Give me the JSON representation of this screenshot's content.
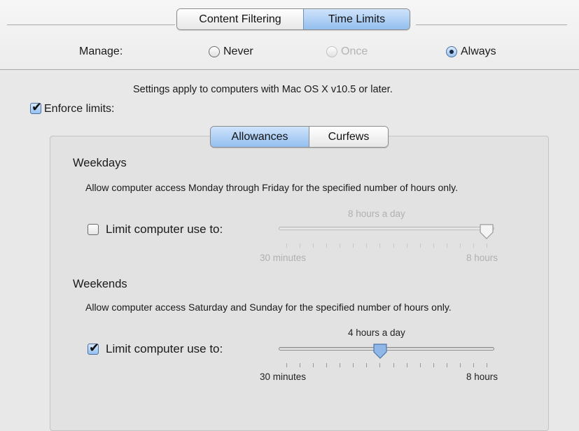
{
  "tabs": [
    {
      "label": "Content Filtering",
      "selected": false
    },
    {
      "label": "Time Limits",
      "selected": true
    }
  ],
  "manage": {
    "label": "Manage:",
    "options": [
      {
        "label": "Never",
        "selected": false,
        "enabled": true
      },
      {
        "label": "Once",
        "selected": false,
        "enabled": false
      },
      {
        "label": "Always",
        "selected": true,
        "enabled": true
      }
    ]
  },
  "info_text": "Settings apply to computers with Mac OS X v10.5 or later.",
  "enforce": {
    "label": "Enforce limits:",
    "checked": true
  },
  "subtabs": [
    {
      "label": "Allowances",
      "selected": true
    },
    {
      "label": "Curfews",
      "selected": false
    }
  ],
  "weekdays": {
    "heading": "Weekdays",
    "description": "Allow computer access Monday through Friday for the specified number of hours only.",
    "limit_label": "Limit computer use to:",
    "limit_checked": false,
    "value_text": "8 hours a day",
    "slider_fraction": 1.0,
    "min_label": "30 minutes",
    "max_label": "8 hours"
  },
  "weekends": {
    "heading": "Weekends",
    "description": "Allow computer access Saturday and Sunday for the specified number of hours only.",
    "limit_label": "Limit computer use to:",
    "limit_checked": true,
    "value_text": "4 hours a day",
    "slider_fraction": 0.467,
    "min_label": "30 minutes",
    "max_label": "8 hours"
  },
  "colors": {
    "accent": "#93bfef",
    "disabled_text": "#b4b4b4"
  }
}
